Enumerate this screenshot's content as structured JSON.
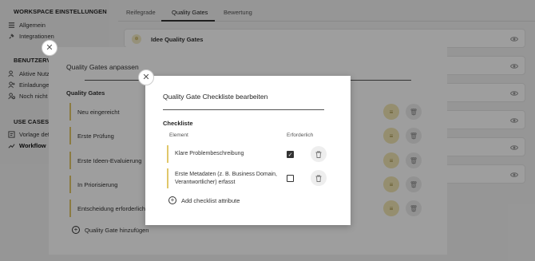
{
  "sidebar": {
    "workspace_heading": "WORKSPACE EINSTELLUNGEN",
    "workspace_items": [
      {
        "label": "Allgemein",
        "icon": "list-icon"
      },
      {
        "label": "Integrationen",
        "icon": "plug-icon"
      }
    ],
    "users_heading": "BENUTZERVE",
    "users_items": [
      {
        "label": "Aktive Nutz",
        "icon": "users-icon"
      },
      {
        "label": "Einladunge",
        "icon": "user-plus-icon"
      },
      {
        "label": "Noch nicht",
        "icon": "user-clock-icon"
      }
    ],
    "usecases_heading": "USE CASES",
    "usecases_items": [
      {
        "label": "Vorlage def",
        "icon": "template-icon"
      },
      {
        "label": "Workflow",
        "icon": "workflow-icon",
        "active": true
      }
    ]
  },
  "tabs": [
    "Reifegrade",
    "Quality Gates",
    "Bewertung"
  ],
  "active_tab": "Quality Gates",
  "background_card": {
    "badge": "⊕",
    "title": "Idee Quality Gates"
  },
  "dialog_outer": {
    "title": "Quality Gates anpassen",
    "section_label": "Quality Gates",
    "gates": [
      "Neu eingereicht",
      "Erste Prüfung",
      "Erste Ideen-Evaluierung",
      "In Priorisierung",
      "Entscheidung erforderlich"
    ],
    "add_label": "Quality Gate hinzufügen"
  },
  "dialog_inner": {
    "title": "Quality Gate Checkliste bearbeiten",
    "section_label": "Checkliste",
    "col_element": "Element",
    "col_required": "Erforderlich",
    "items": [
      {
        "text": "Klare Problembeschreibung",
        "required": true
      },
      {
        "text": "Erste Metadaten (z. B. Business Domain, Verantwortlicher) erfasst",
        "required": false
      }
    ],
    "add_label": "Add checklist attribute"
  },
  "colors": {
    "accent_yellow": "#e0c76a",
    "edit_bg": "#f1e6b3",
    "overlay": "rgba(0,0,0,0.38)"
  }
}
